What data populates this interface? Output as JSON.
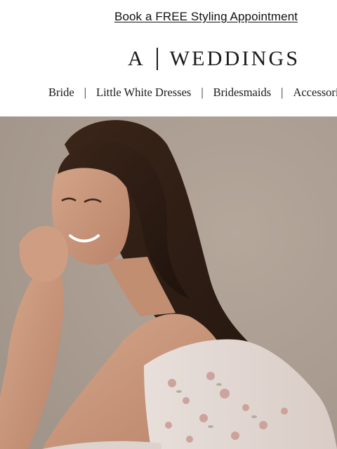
{
  "promo": {
    "link_text": "Book a FREE Styling Appointment"
  },
  "logo": {
    "mark": "A",
    "word": "WEDDINGS"
  },
  "nav": {
    "items": [
      {
        "label": "Bride"
      },
      {
        "label": "Little White Dresses"
      },
      {
        "label": "Bridesmaids"
      },
      {
        "label": "Accessories"
      }
    ],
    "separator": "|"
  },
  "hero": {
    "image_icon": "photo-icon"
  },
  "colors": {
    "text": "#1a1a1a",
    "hero_background": "#ab9d90",
    "hair": "#2a1a12",
    "skin": "#c9977a",
    "dress": "#e6dcd6",
    "floral": "#c99a94"
  }
}
